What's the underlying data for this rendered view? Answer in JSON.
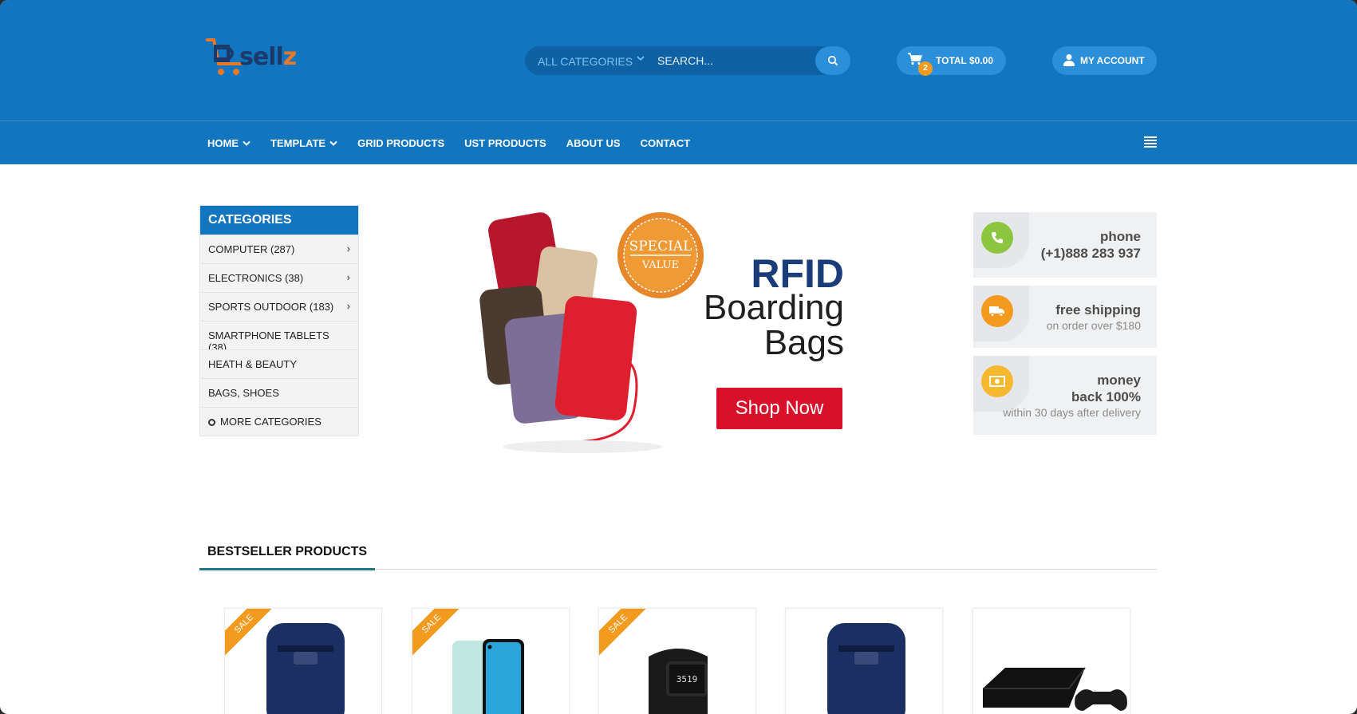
{
  "brand": {
    "name_prefix": "D",
    "name_main": "sell",
    "name_suffix": "z"
  },
  "search": {
    "category": "ALL CATEGORIES",
    "placeholder": "SEARCH..."
  },
  "cart": {
    "count": "2",
    "total": "TOTAL $0.00"
  },
  "account": {
    "label": "MY ACCOUNT"
  },
  "nav": {
    "items": [
      {
        "label": "HOME",
        "has_dropdown": true
      },
      {
        "label": "TEMPLATE",
        "has_dropdown": true
      },
      {
        "label": "GRID PRODUCTS",
        "has_dropdown": false
      },
      {
        "label": "UST PRODUCTS",
        "has_dropdown": false
      },
      {
        "label": "ABOUT US",
        "has_dropdown": false
      },
      {
        "label": "CONTACT",
        "has_dropdown": false
      }
    ]
  },
  "categories": {
    "title": "CATEGORIES",
    "items": [
      {
        "label": "COMPUTER (287)",
        "has_sub": true
      },
      {
        "label": "ELECTRONICS (38)",
        "has_sub": true
      },
      {
        "label": "SPORTS OUTDOOR (183)",
        "has_sub": true
      },
      {
        "label": "SMARTPHONE TABLETS (38)",
        "has_sub": false
      },
      {
        "label": "HEATH & BEAUTY",
        "has_sub": false
      },
      {
        "label": "BAGS, SHOES",
        "has_sub": false
      }
    ],
    "more": "MORE CATEGORIES"
  },
  "banner": {
    "seal_top": "SPECIAL",
    "seal_bottom": "VALUE",
    "headline": "RFID",
    "sub_line1": "Boarding",
    "sub_line2": "Bags",
    "cta": "Shop Now"
  },
  "info": {
    "phone": {
      "title": "phone",
      "value": "(+1)888 283 937",
      "icon": "phone-icon",
      "color": "#8cc63f"
    },
    "shipping": {
      "title": "free shipping",
      "sub": "on order over $180",
      "icon": "truck-icon",
      "color": "#f39a1f"
    },
    "money": {
      "title_line1": "money",
      "title_line2": "back 100%",
      "sub": "within 30 days after delivery",
      "icon": "money-icon",
      "color": "#f5b82e"
    }
  },
  "bestseller": {
    "title": "BESTSELLER PRODUCTS",
    "products": [
      {
        "sale": "SALE",
        "image": "backpack"
      },
      {
        "sale": "SALE",
        "image": "smartphone"
      },
      {
        "sale": "SALE",
        "image": "smartwatch"
      },
      {
        "sale": "",
        "image": "backpack"
      },
      {
        "sale": "",
        "image": "game-console"
      }
    ]
  },
  "colors": {
    "primary": "#1275bf",
    "accent": "#f39a1f",
    "cta": "#d9102a"
  }
}
